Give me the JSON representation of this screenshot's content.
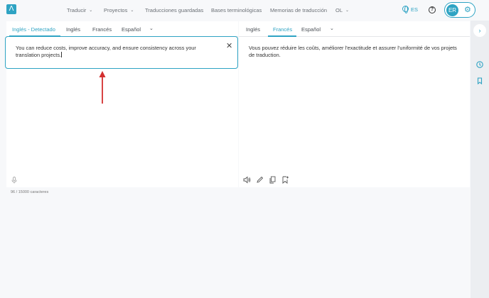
{
  "header": {
    "logo_glyph": "Λ",
    "nav": [
      {
        "label": "Traducir",
        "chevron": true
      },
      {
        "label": "Proyectos",
        "chevron": true
      },
      {
        "label": "Traducciones guardadas",
        "chevron": false
      },
      {
        "label": "Bases terminológicas",
        "chevron": false
      },
      {
        "label": "Memorias de traducción",
        "chevron": false
      },
      {
        "label": "OL",
        "chevron": true
      }
    ],
    "ui_language": "ES",
    "avatar_initials": "ER"
  },
  "source": {
    "tabs": [
      "Inglés - Detectado",
      "Inglés",
      "Francés",
      "Español"
    ],
    "active_tab": "Inglés - Detectado",
    "text": "You can reduce costs, improve accuracy, and ensure consistency across your translation projects.",
    "char_count": "96 / 15000 caracteres"
  },
  "target": {
    "tabs": [
      "Inglés",
      "Francés",
      "Español"
    ],
    "active_tab": "Francés",
    "text": "Vous pouvez réduire les coûts, améliorer l'exactitude et assurer l'uniformité de vos projets de traduction."
  },
  "colors": {
    "accent": "#2ea3c3",
    "annotation_arrow": "#d32f2f"
  }
}
